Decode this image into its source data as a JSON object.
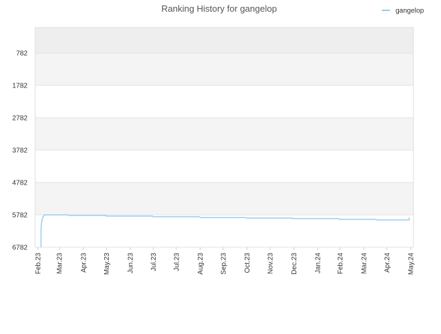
{
  "chart_data": {
    "type": "line",
    "title": "Ranking History for gangelop",
    "xlabel": "",
    "ylabel": "",
    "y_inverted": true,
    "ylim": [
      6782,
      0
    ],
    "y_ticks": [
      782,
      1782,
      2782,
      3782,
      4782,
      5782,
      6782
    ],
    "y_tick_labels": [
      "782",
      "1782",
      "2782",
      "3782",
      "4782",
      "5782",
      "6782"
    ],
    "x_tick_dates": [
      "2023-02-01",
      "2023-03-01",
      "2023-04-01",
      "2023-05-01",
      "2023-06-01",
      "2023-07-01",
      "2023-07-31",
      "2023-08-31",
      "2023-09-30",
      "2023-10-31",
      "2023-11-30",
      "2023-12-31",
      "2024-01-31",
      "2024-02-29",
      "2024-03-31",
      "2024-04-30",
      "2024-05-31"
    ],
    "x_tick_labels": [
      "Feb.23",
      "Mar.23",
      "Apr.23",
      "May.23",
      "Jun.23",
      "Jul.23",
      "Jul.23",
      "Aug.23",
      "Sep.23",
      "Oct.23",
      "Nov.23",
      "Dec.23",
      "Jan.24",
      "Feb.24",
      "Mar.24",
      "Apr.24",
      "May.24"
    ],
    "xlim": [
      "2023-02-01",
      "2024-05-31"
    ],
    "grid": true,
    "legend": {
      "position": "top-right"
    },
    "series": [
      {
        "name": "gangelop",
        "color": "#99ccee",
        "points": [
          [
            "2023-02-05",
            6782
          ],
          [
            "2023-02-05",
            6200
          ],
          [
            "2023-02-06",
            5980
          ],
          [
            "2023-02-07",
            5880
          ],
          [
            "2023-02-09",
            5790
          ],
          [
            "2023-02-12",
            5782
          ],
          [
            "2023-03-12",
            5782
          ],
          [
            "2023-03-13",
            5800
          ],
          [
            "2023-04-30",
            5800
          ],
          [
            "2023-05-01",
            5820
          ],
          [
            "2023-06-30",
            5820
          ],
          [
            "2023-07-01",
            5840
          ],
          [
            "2023-08-30",
            5840
          ],
          [
            "2023-08-31",
            5860
          ],
          [
            "2023-10-29",
            5860
          ],
          [
            "2023-10-30",
            5880
          ],
          [
            "2023-12-29",
            5880
          ],
          [
            "2023-12-30",
            5900
          ],
          [
            "2024-02-27",
            5900
          ],
          [
            "2024-02-28",
            5920
          ],
          [
            "2024-04-16",
            5920
          ],
          [
            "2024-04-17",
            5940
          ],
          [
            "2024-05-29",
            5940
          ],
          [
            "2024-05-29",
            5860
          ]
        ]
      }
    ]
  }
}
